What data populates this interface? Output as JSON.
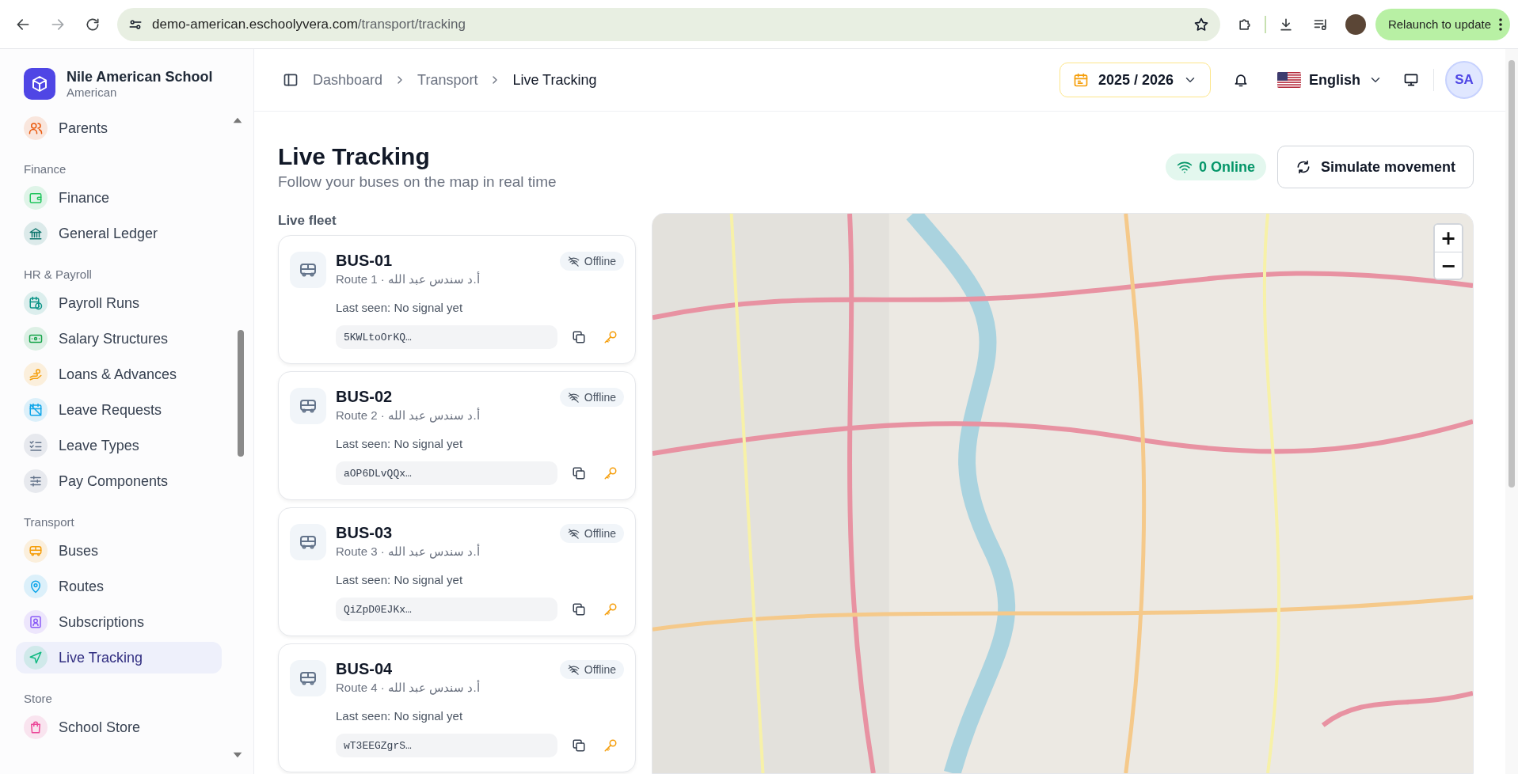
{
  "browser": {
    "url_host": "demo-american.eschoolyvera.com",
    "url_path": "/transport/tracking",
    "forward_disabled": true,
    "relaunch_button": "Relaunch to update"
  },
  "sidebar": {
    "school_name": "Nile American School",
    "school_type": "American",
    "groups": [
      {
        "items": [
          {
            "label": "Parents",
            "color": "#ea580c",
            "selected": false
          }
        ]
      },
      {
        "title": "Finance",
        "items": [
          {
            "label": "Finance",
            "color": "#22c55e",
            "selected": false
          },
          {
            "label": "General Ledger",
            "color": "#0f766e",
            "selected": false
          }
        ]
      },
      {
        "title": "HR & Payroll",
        "items": [
          {
            "label": "Payroll Runs",
            "color": "#0d9488",
            "selected": false
          },
          {
            "label": "Salary Structures",
            "color": "#16a34a",
            "selected": false
          },
          {
            "label": "Loans & Advances",
            "color": "#f59e0b",
            "selected": false
          },
          {
            "label": "Leave Requests",
            "color": "#0ea5e9",
            "selected": false
          },
          {
            "label": "Leave Types",
            "color": "#64748b",
            "selected": false
          },
          {
            "label": "Pay Components",
            "color": "#64748b",
            "selected": false
          }
        ]
      },
      {
        "title": "Transport",
        "items": [
          {
            "label": "Buses",
            "color": "#f59e0b",
            "selected": false
          },
          {
            "label": "Routes",
            "color": "#0ea5e9",
            "selected": false
          },
          {
            "label": "Subscriptions",
            "color": "#8b5cf6",
            "selected": false
          },
          {
            "label": "Live Tracking",
            "color": "#10b981",
            "selected": true
          }
        ]
      },
      {
        "title": "Store",
        "items": [
          {
            "label": "School Store",
            "color": "#ec4899",
            "selected": false
          }
        ]
      }
    ]
  },
  "header": {
    "breadcrumbs": [
      "Dashboard",
      "Transport",
      "Live Tracking"
    ],
    "year": "2025 / 2026",
    "language": "English",
    "avatar": "SA"
  },
  "page": {
    "title": "Live Tracking",
    "subtitle": "Follow your buses on the map in real time",
    "online_badge": "0 Online",
    "simulate_button": "Simulate movement"
  },
  "fleet": {
    "title": "Live fleet",
    "buses": [
      {
        "name": "BUS-01",
        "route": "Route 1 · أ.د سندس عبد الله",
        "last_seen": "Last seen: No signal yet",
        "token": "5KWLtoOrKQ…",
        "status": "Offline",
        "online": false
      },
      {
        "name": "BUS-02",
        "route": "Route 2 · أ.د سندس عبد الله",
        "last_seen": "Last seen: No signal yet",
        "token": "aOP6DLvQQx…",
        "status": "Offline",
        "online": false
      },
      {
        "name": "BUS-03",
        "route": "Route 3 · أ.د سندس عبد الله",
        "last_seen": "Last seen: No signal yet",
        "token": "QiZpD0EJKx…",
        "status": "Offline",
        "online": false
      },
      {
        "name": "BUS-04",
        "route": "Route 4 · أ.د سندس عبد الله",
        "last_seen": "Last seen: No signal yet",
        "token": "wT3EEGZgrS…",
        "status": "Offline",
        "online": false
      }
    ]
  },
  "map": {
    "zoom_in": "+",
    "zoom_out": "−"
  }
}
